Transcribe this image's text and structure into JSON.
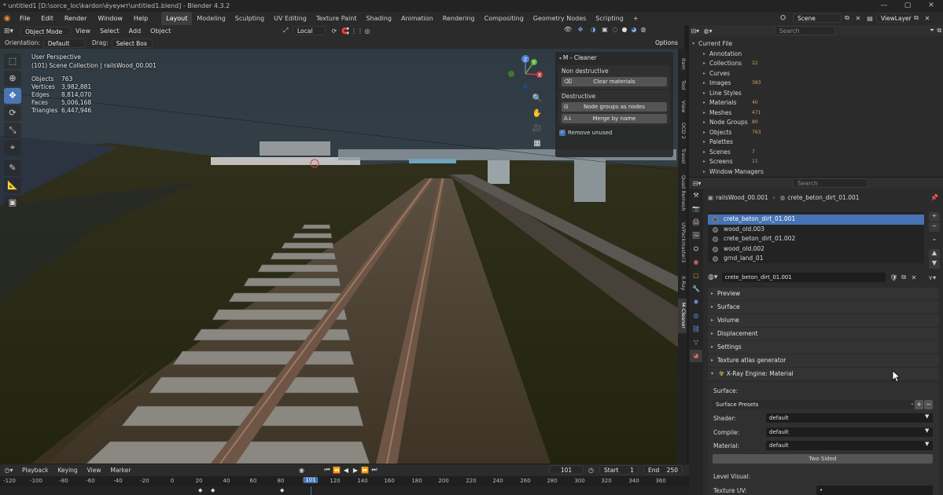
{
  "window": {
    "title": "* untitled1 [D:\\sorce_loc\\kardon\\ёуеумт\\untitled1.blend] - Blender 4.3.2",
    "controls": [
      "—",
      "▢",
      "✕"
    ]
  },
  "menu": {
    "items": [
      "File",
      "Edit",
      "Render",
      "Window",
      "Help"
    ],
    "workspaces": [
      "Layout",
      "Modeling",
      "Sculpting",
      "UV Editing",
      "Texture Paint",
      "Shading",
      "Animation",
      "Rendering",
      "Compositing",
      "Geometry Nodes",
      "Scripting"
    ],
    "active_workspace": "Layout",
    "add_tab": "+",
    "scene": "Scene",
    "view_layer": "ViewLayer"
  },
  "viewport_header": {
    "mode": "Object Mode",
    "view": "View",
    "select": "Select",
    "add": "Add",
    "object": "Object",
    "transform": "Local",
    "orientation_label": "Orientation:",
    "orientation_value": "Default",
    "drag_label": "Drag:",
    "drag_value": "Select Box",
    "options": "Options"
  },
  "viewport": {
    "perspective": "User Perspective",
    "collection": "(101) Scene Collection | railsWood_00.001",
    "stats": [
      {
        "label": "Objects",
        "value": "763"
      },
      {
        "label": "Vertices",
        "value": "3,982,881"
      },
      {
        "label": "Edges",
        "value": "8,814,070"
      },
      {
        "label": "Faces",
        "value": "5,006,168"
      },
      {
        "label": "Triangles",
        "value": "6,447,946"
      }
    ],
    "gizmo_axes": [
      "Z",
      "Y",
      "X"
    ]
  },
  "mcleaner": {
    "title": "M - Cleaner",
    "non_destructive": "Non destructive",
    "clear_materials": "Clear materials",
    "destructive": "Destructive",
    "node_groups_as_nodes": "Node groups as nodes",
    "merge_by_name": "Merge by name",
    "remove_unused": "Remove unused"
  },
  "side_tabs": [
    "Item",
    "Tool",
    "View",
    "OCD 2",
    "Travel",
    "Quad Remesh",
    "UVPackmaster3",
    "X-Ray",
    "M-Cleaner"
  ],
  "outliner": {
    "search_placeholder": "Search",
    "root": "Current File",
    "items": [
      {
        "label": "Annotation",
        "count": ""
      },
      {
        "label": "Collections",
        "count": "22"
      },
      {
        "label": "Curves",
        "count": ""
      },
      {
        "label": "Images",
        "count": "383"
      },
      {
        "label": "Line Styles",
        "count": ""
      },
      {
        "label": "Materials",
        "count": "40"
      },
      {
        "label": "Meshes",
        "count": "471"
      },
      {
        "label": "Node Groups",
        "count": "80"
      },
      {
        "label": "Objects",
        "count": "763"
      },
      {
        "label": "Palettes",
        "count": ""
      },
      {
        "label": "Scenes",
        "count": "7"
      },
      {
        "label": "Screens",
        "count": "11"
      },
      {
        "label": "Window Managers",
        "count": ""
      }
    ]
  },
  "properties": {
    "search_placeholder": "Search",
    "breadcrumb_object": "railsWood_00.001",
    "breadcrumb_material": "crete_beton_dirt_01.001",
    "slots": [
      "crete_beton_dirt_01.001",
      "wood_old.003",
      "crete_beton_dirt_01.002",
      "wood_old.002",
      "grnd_land_01"
    ],
    "selected_slot": 0,
    "material_name": "crete_beton_dirt_01.001",
    "panels": [
      "Preview",
      "Surface",
      "Volume",
      "Displacement",
      "Settings",
      "Texture atlas generator"
    ],
    "xray": {
      "header": "X-Ray Engine: Material",
      "surface_label": "Surface:",
      "surface_presets": "Surface Presets",
      "shader_label": "Shader:",
      "shader_value": "default",
      "compile_label": "Compile:",
      "compile_value": "default",
      "material_label": "Material:",
      "material_value": "default",
      "two_sided": "Two Sided",
      "level_visual": "Level Visual:",
      "texture_uv": "Texture UV:",
      "texture_uv_value": "•"
    }
  },
  "timeline": {
    "menu": [
      "Playback",
      "Keying",
      "View",
      "Marker"
    ],
    "current_frame": "101",
    "start_label": "Start",
    "start_value": "1",
    "end_label": "End",
    "end_value": "250",
    "ruler": [
      "-120",
      "-100",
      "-80",
      "-60",
      "-40",
      "-20",
      "0",
      "20",
      "40",
      "60",
      "80",
      "101",
      "120",
      "140",
      "160",
      "180",
      "200",
      "220",
      "240",
      "260",
      "280",
      "300",
      "320",
      "340",
      "360"
    ]
  }
}
